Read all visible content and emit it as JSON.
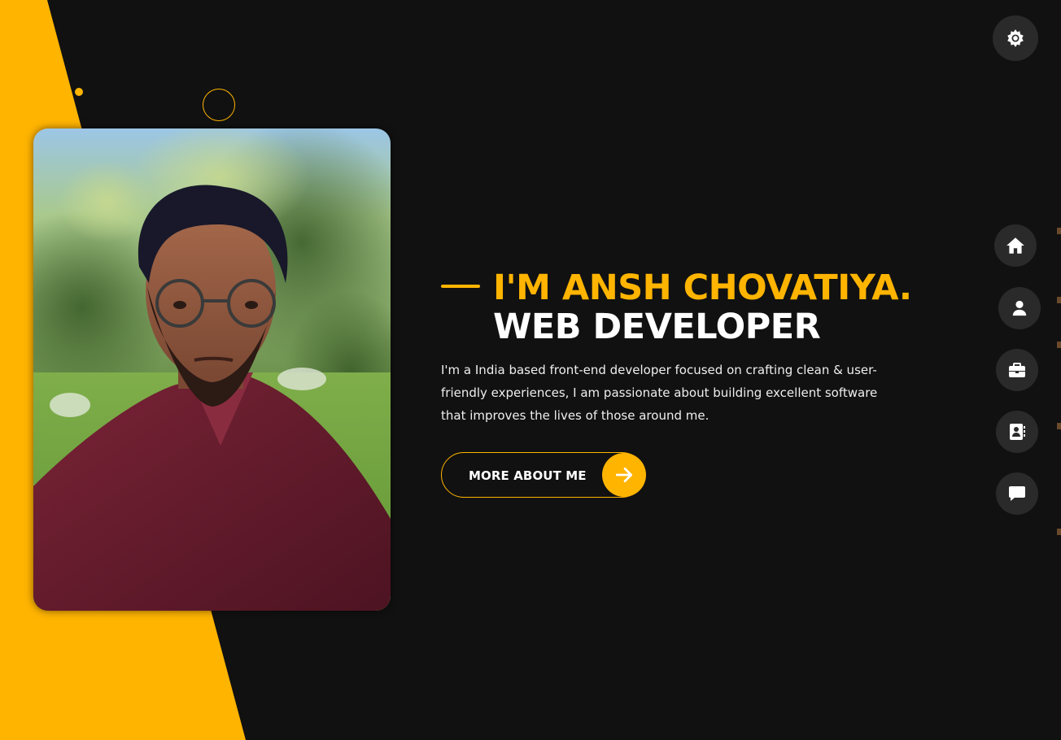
{
  "colors": {
    "accent": "#ffb400",
    "background": "#111111",
    "nav_button": "#2b2a2a",
    "text_primary": "#ffffff",
    "text_body": "#eeeeee"
  },
  "header": {
    "theme_toggle_icon": "gear-icon"
  },
  "nav": {
    "items": [
      {
        "icon": "home-icon"
      },
      {
        "icon": "user-icon"
      },
      {
        "icon": "briefcase-icon"
      },
      {
        "icon": "contact-book-icon"
      },
      {
        "icon": "chat-icon"
      }
    ]
  },
  "hero": {
    "title_line1": "I'M ANSH CHOVATIYA.",
    "title_line2": "WEB DEVELOPER",
    "bio": "I'm a India based front-end developer focused on crafting clean & user-friendly experiences, I am passionate about building excellent software that improves the lives of those around me.",
    "cta_label": "MORE ABOUT ME",
    "cta_icon": "arrow-right-icon"
  },
  "profile_photo": {
    "icon": "profile-photo"
  }
}
